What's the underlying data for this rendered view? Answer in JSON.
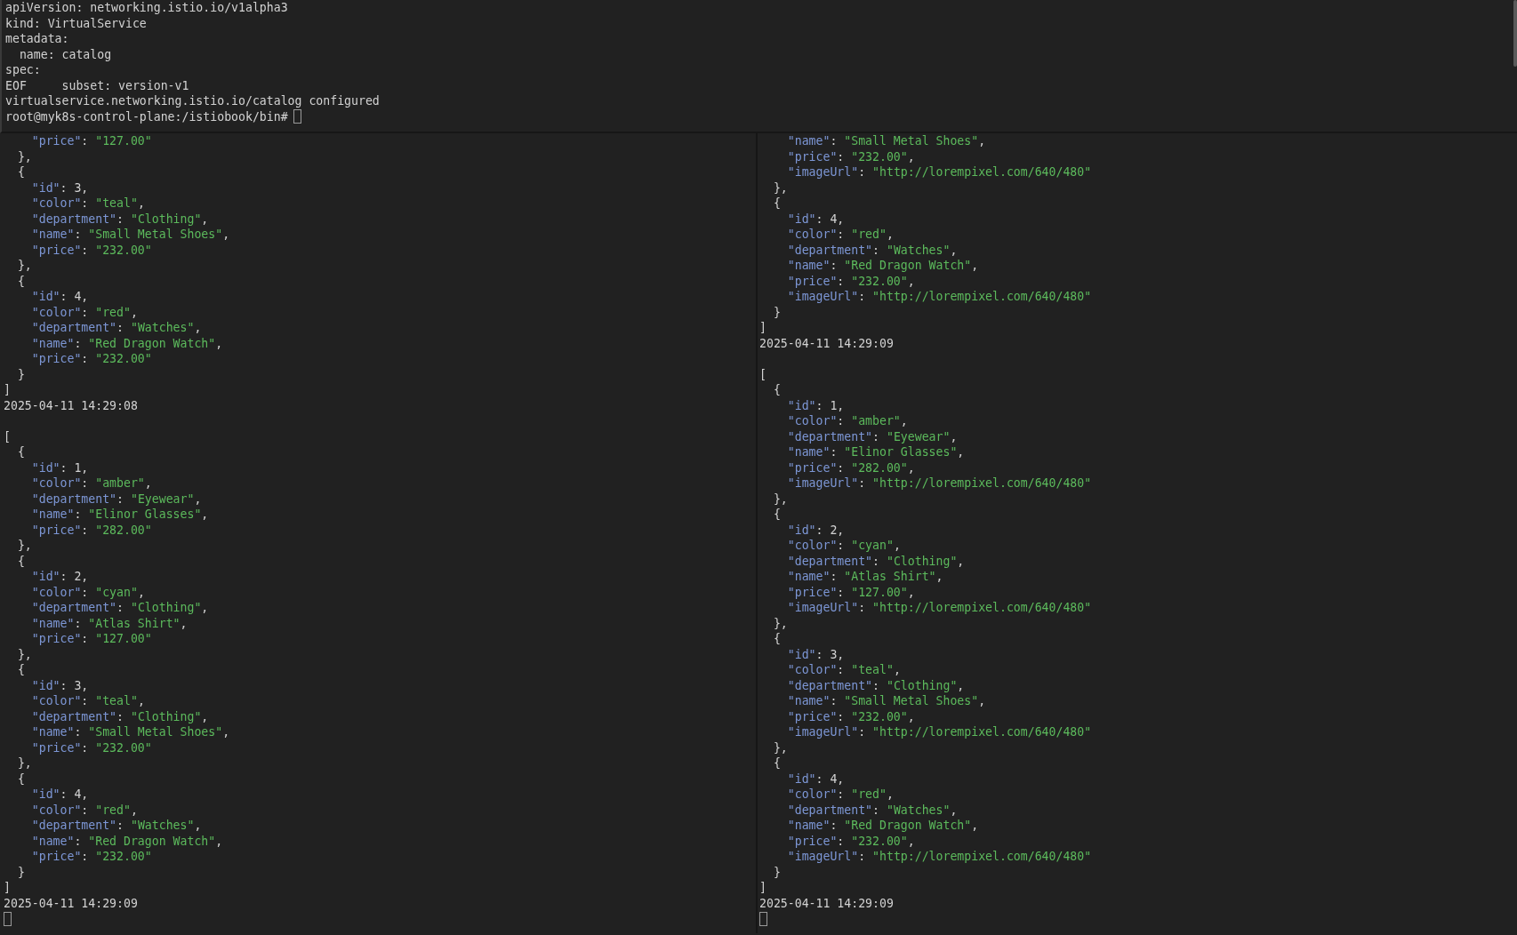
{
  "top_pane": {
    "lines": [
      "apiVersion: networking.istio.io/v1alpha3",
      "kind: VirtualService",
      "metadata:",
      "  name: catalog",
      "spec:",
      "EOF     subset: version-v1",
      "virtualservice.networking.istio.io/catalog configured"
    ],
    "prompt": "root@myk8s-control-plane:/istiobook/bin#",
    "cursor": true
  },
  "left_pane": {
    "blocks": [
      {
        "lines": [
          "    \"price\": \"127.00\"",
          "  },",
          "  {",
          "    \"id\": 3,",
          "    \"color\": \"teal\",",
          "    \"department\": \"Clothing\",",
          "    \"name\": \"Small Metal Shoes\",",
          "    \"price\": \"232.00\"",
          "  },",
          "  {",
          "    \"id\": 4,",
          "    \"color\": \"red\",",
          "    \"department\": \"Watches\",",
          "    \"name\": \"Red Dragon Watch\",",
          "    \"price\": \"232.00\"",
          "  }",
          "]"
        ],
        "timestamp": "2025-04-11 14:29:08"
      },
      {
        "lines": [
          "[",
          "  {",
          "    \"id\": 1,",
          "    \"color\": \"amber\",",
          "    \"department\": \"Eyewear\",",
          "    \"name\": \"Elinor Glasses\",",
          "    \"price\": \"282.00\"",
          "  },",
          "  {",
          "    \"id\": 2,",
          "    \"color\": \"cyan\",",
          "    \"department\": \"Clothing\",",
          "    \"name\": \"Atlas Shirt\",",
          "    \"price\": \"127.00\"",
          "  },",
          "  {",
          "    \"id\": 3,",
          "    \"color\": \"teal\",",
          "    \"department\": \"Clothing\",",
          "    \"name\": \"Small Metal Shoes\",",
          "    \"price\": \"232.00\"",
          "  },",
          "  {",
          "    \"id\": 4,",
          "    \"color\": \"red\",",
          "    \"department\": \"Watches\",",
          "    \"name\": \"Red Dragon Watch\",",
          "    \"price\": \"232.00\"",
          "  }",
          "]"
        ],
        "timestamp": "2025-04-11 14:29:09"
      }
    ],
    "cursor": true
  },
  "right_pane": {
    "blocks": [
      {
        "lines": [
          "    \"name\": \"Small Metal Shoes\",",
          "    \"price\": \"232.00\",",
          "    \"imageUrl\": \"http://lorempixel.com/640/480\"",
          "  },",
          "  {",
          "    \"id\": 4,",
          "    \"color\": \"red\",",
          "    \"department\": \"Watches\",",
          "    \"name\": \"Red Dragon Watch\",",
          "    \"price\": \"232.00\",",
          "    \"imageUrl\": \"http://lorempixel.com/640/480\"",
          "  }",
          "]"
        ],
        "timestamp": "2025-04-11 14:29:09"
      },
      {
        "lines": [
          "[",
          "  {",
          "    \"id\": 1,",
          "    \"color\": \"amber\",",
          "    \"department\": \"Eyewear\",",
          "    \"name\": \"Elinor Glasses\",",
          "    \"price\": \"282.00\",",
          "    \"imageUrl\": \"http://lorempixel.com/640/480\"",
          "  },",
          "  {",
          "    \"id\": 2,",
          "    \"color\": \"cyan\",",
          "    \"department\": \"Clothing\",",
          "    \"name\": \"Atlas Shirt\",",
          "    \"price\": \"127.00\",",
          "    \"imageUrl\": \"http://lorempixel.com/640/480\"",
          "  },",
          "  {",
          "    \"id\": 3,",
          "    \"color\": \"teal\",",
          "    \"department\": \"Clothing\",",
          "    \"name\": \"Small Metal Shoes\",",
          "    \"price\": \"232.00\",",
          "    \"imageUrl\": \"http://lorempixel.com/640/480\"",
          "  },",
          "  {",
          "    \"id\": 4,",
          "    \"color\": \"red\",",
          "    \"department\": \"Watches\",",
          "    \"name\": \"Red Dragon Watch\",",
          "    \"price\": \"232.00\",",
          "    \"imageUrl\": \"http://lorempixel.com/640/480\"",
          "  }",
          "]"
        ],
        "timestamp": "2025-04-11 14:29:09"
      }
    ],
    "cursor": true
  }
}
